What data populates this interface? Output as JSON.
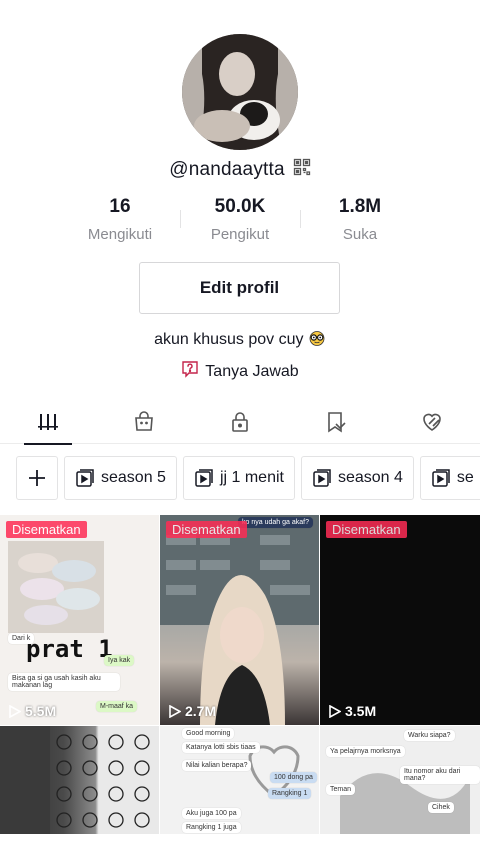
{
  "profile": {
    "username": "@nandaaytta",
    "bio": "akun khusus pov cuy",
    "qa_label": "Tanya Jawab",
    "edit_label": "Edit profil"
  },
  "stats": [
    {
      "value": "16",
      "label": "Mengikuti"
    },
    {
      "value": "50.0K",
      "label": "Pengikut"
    },
    {
      "value": "1.8M",
      "label": "Suka"
    }
  ],
  "tabs": [
    {
      "name": "videos-tab",
      "icon": "grid-icon",
      "active": true
    },
    {
      "name": "shop-tab",
      "icon": "bag-icon"
    },
    {
      "name": "private-tab",
      "icon": "lock-icon"
    },
    {
      "name": "saved-tab",
      "icon": "bookmark-icon"
    },
    {
      "name": "liked-tab",
      "icon": "heart-icon"
    }
  ],
  "playlists": [
    "season 5",
    "jj 1 menit",
    "season 4",
    "se"
  ],
  "videos": [
    {
      "pinned_label": "Disematkan",
      "views": "5.5M",
      "overlay_text": "prat 1"
    },
    {
      "pinned_label": "Disematkan",
      "views": "2.7M"
    },
    {
      "pinned_label": "Disematkan",
      "views": "3.5M"
    }
  ],
  "chat_snippets": {
    "v1": [
      "Dari k",
      "Iya kak",
      "Bisa ga si ga usah kasih aku makanan lag",
      "M-maaf ka"
    ],
    "v2": [
      "ko nya udah ga akaf?"
    ],
    "v5": [
      "Good morning",
      "Katanya lotti sbis tiaas",
      "Nilai kalian berapa?",
      "100 dong pa",
      "Rangking 1",
      "Aku juga 100 pa",
      "Rangking 1 juga"
    ],
    "v6": [
      "Warku siapa?",
      "Ya pelajrnya morksnya",
      "Itu nomor aku dari mana?",
      "Teman",
      "Cihek"
    ]
  },
  "colors": {
    "accent": "#fe2c55",
    "text": "#161823",
    "muted": "#8a8b91"
  }
}
